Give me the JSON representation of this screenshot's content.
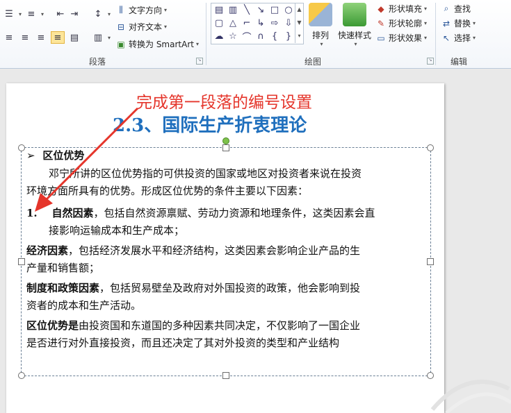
{
  "ribbon": {
    "groups": {
      "paragraph": "段落",
      "drawing": "绘图",
      "editing": "编辑"
    },
    "paragraph_buttons": {
      "text_direction": "文字方向",
      "align_text": "对齐文本",
      "convert_smartart": "转换为 SmartArt"
    },
    "drawing_buttons": {
      "arrange": "排列",
      "quick_styles": "快速样式",
      "shape_fill": "形状填充",
      "shape_outline": "形状轮廓",
      "shape_effects": "形状效果"
    },
    "editing_buttons": {
      "find": "查找",
      "replace": "替换",
      "select": "选择"
    }
  },
  "slide": {
    "annotation": "完成第一段落的编号设置",
    "title": "2.3、国际生产折衷理论",
    "content": {
      "heading_marker": "➢",
      "heading": "区位优势",
      "intro_line1": "邓宁所讲的区位优势指的可供投资的国家或地区对投资者来说在投资",
      "intro_line2": "环境方面所具有的优势。形成区位优势的条件主要以下因素：",
      "item1_number": "1.",
      "item1_bold": "自然因素",
      "item1_rest": "，包括自然资源禀赋、劳动力资源和地理条件，这类因素会直",
      "item1_line2": "接影响运输成本和生产成本；",
      "item2_bold": "经济因素",
      "item2_rest": "，包括经济发展水平和经济结构，这类因素会影响企业产品的生",
      "item2_line2": "产量和销售额；",
      "item3_bold": "制度和政策因素",
      "item3_rest": "，包括贸易壁垒及政府对外国投资的政策，他会影响到投",
      "item3_line2": "资者的成本和生产活动。",
      "item4_bold": "区位优势是",
      "item4_rest": "由投资国和东道国的多种因素共同决定，不仅影响了一国企业",
      "item4_line2": "是否进行对外直接投资，而且还决定了其对外投资的类型和产业结构"
    }
  },
  "colors": {
    "annotation": "#e5352b",
    "title": "#1f6fbd",
    "arrow": "#e5352b"
  }
}
